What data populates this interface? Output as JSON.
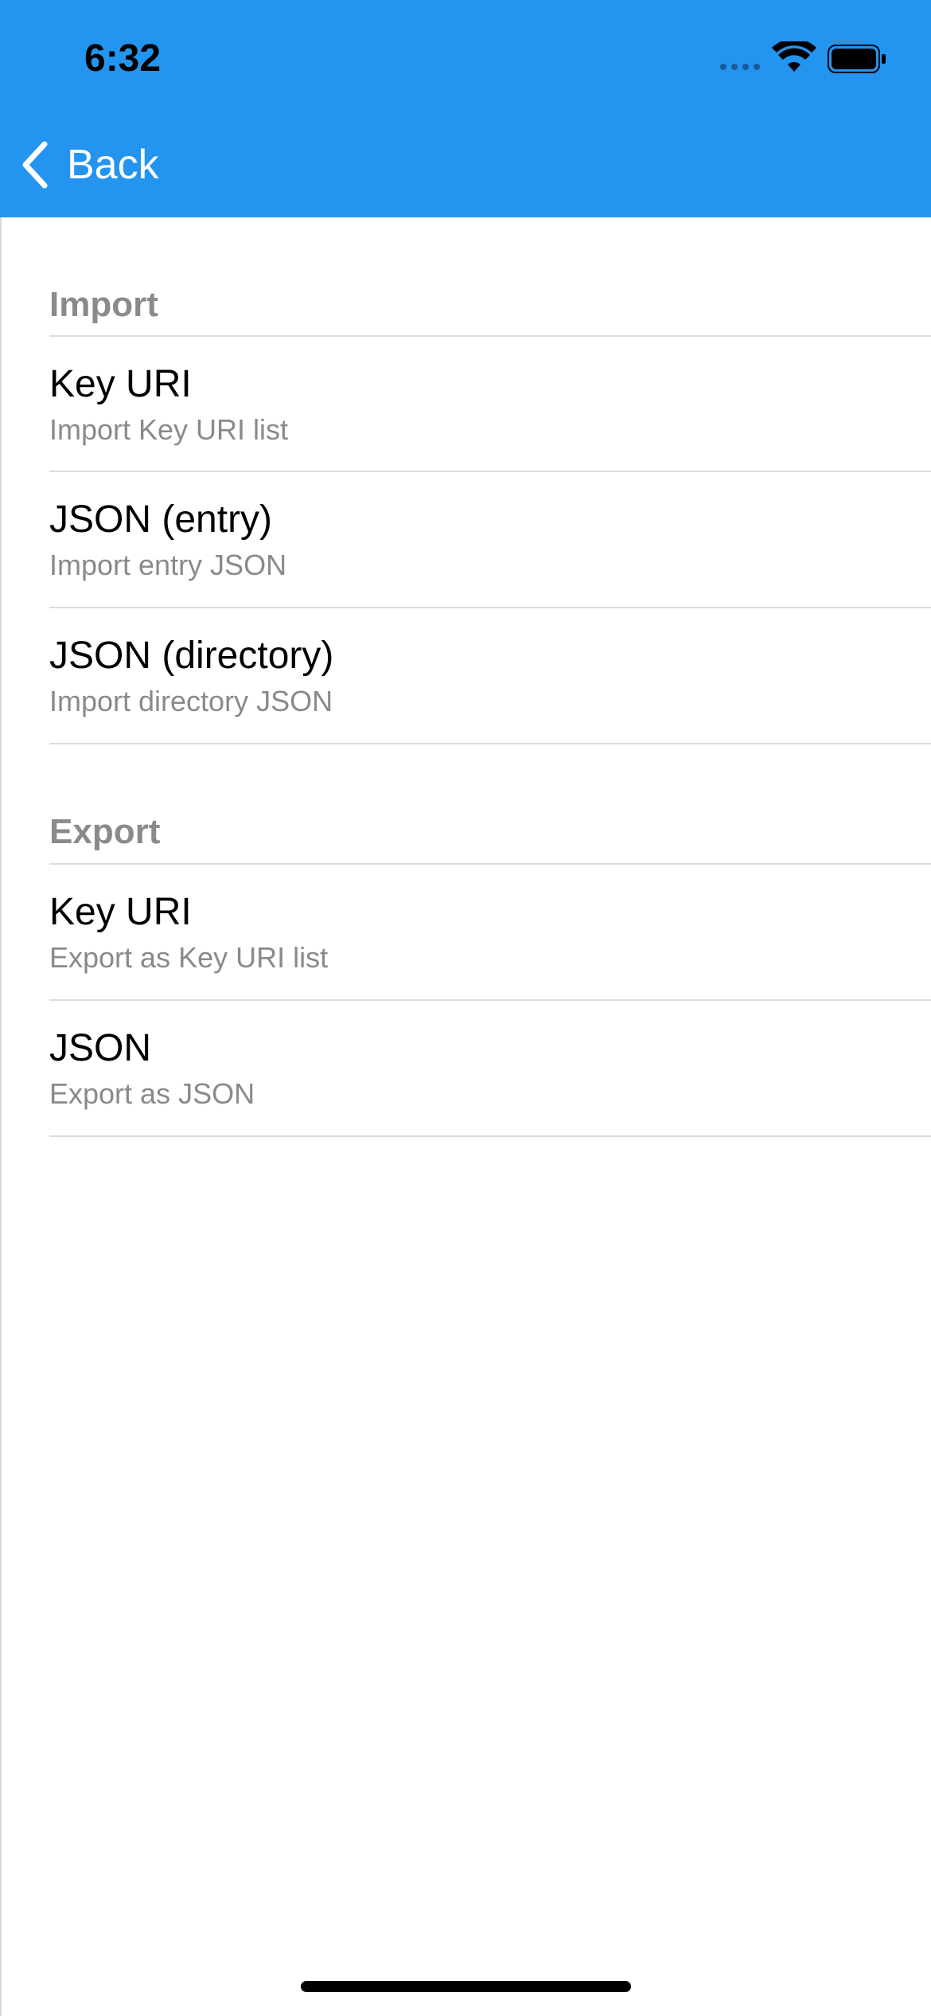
{
  "status_bar": {
    "time": "6:32",
    "icons": [
      "signal-icon",
      "wifi-icon",
      "battery-icon"
    ]
  },
  "nav": {
    "back_label": "Back",
    "back_icon": "chevron-left-icon",
    "bar_color": "#2394F0"
  },
  "sections": [
    {
      "title": "Import",
      "items": [
        {
          "title": "Key URI",
          "subtitle": "Import Key URI list"
        },
        {
          "title": "JSON (entry)",
          "subtitle": "Import entry JSON"
        },
        {
          "title": "JSON (directory)",
          "subtitle": "Import directory JSON"
        }
      ]
    },
    {
      "title": "Export",
      "items": [
        {
          "title": "Key URI",
          "subtitle": "Export as Key URI list"
        },
        {
          "title": "JSON",
          "subtitle": "Export as JSON"
        }
      ]
    }
  ]
}
